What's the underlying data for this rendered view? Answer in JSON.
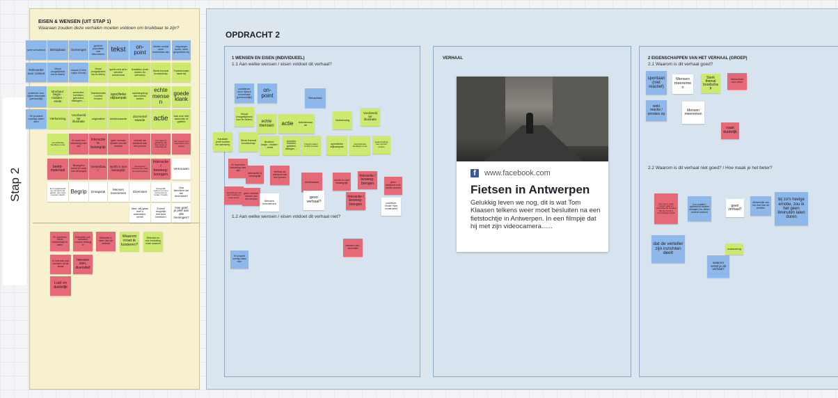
{
  "stap_label": "Stap 2",
  "left_panel": {
    "title": "EISEN & WENSEN (UIT STAP 1)",
    "subtitle": "Waaraan zouden deze verhalen moeten voldoen om bruikbaar te zijn?",
    "stickies": [
      "snel vervelend",
      "Behapbaar",
      "Gemengen",
      "grotere populatie dat interveren",
      "tekst",
      "on-point",
      "idealen omdat meer herkenbaar zijn",
      "mag langer duren, meer gesprekken bij",
      "Relevantie voor context",
      "Visual (mogelijkheid van te delen)",
      "Impact (3 time major events)",
      "Visual (mogelijkheid van te delen)",
      "spelt zich af in wereld/ universum",
      "Karakter (met noden en wensen)",
      "Sterk themal boodschap",
      "Toeleenbare lawn bij",
      "positiever voor rijkere informatie (persoonlijk)",
      "structuur: begin - midden - einde",
      "woorden, beelden, geluiden, dialogen, ...",
      "Transformatie / conflict ervaren",
      "specifieke stijlaanpak",
      "spanningsbog aan eventul anders",
      "echte mensen",
      "goede klank",
      "90 procent overlap laten zien",
      "Herkenning",
      "Voorbeeld ter illustratie",
      "originaliteit",
      "betekenaarde",
      "doorvertel waarde",
      "actie",
      "kan ook met animatie of grafiek",
      "verschillende beeldtypen ook",
      "Er moet een bedoeling mee zijn",
      "Interactie is belangrijk",
      "geen verhaal, emotie van het verhaal",
      "verhaal als startpunt aan een proces",
      "Hoe absurd geleiding van door grote en zekerdaarde",
      "iets visueel, het materiaal in het project",
      "beeld-materiaal",
      "Bewegend beeld (in vaak ook tot langst)",
      "herkenbaar",
      "worth is niet belangrijk",
      "bewegende creating aan twee de totaal fracties",
      "Interactie / beweeg-brengen",
      "Vertrouwen",
      "Er is opgebouwd de moment niet geniet, hoe niets nog kent daarin",
      "Begrip",
      "Draagvlak",
      "Mensen meenemen",
      "Diversiteit",
      "Draagvlak creëren om een consensus te vinden / begrip",
      "Hoe bereiken we die diversiteit?",
      "idee: wij gaan met u wandelen, vertel",
      "Zoveel mogelijk mensen bereiken",
      "Hoe geef je plek aan alle meningen?",
      "Er moet een mens herkenbaar in zitten",
      "Evenzeer ook verhalen rondom betoog of",
      "Behoefte is meer dan het verhaal",
      "Waarom moet ik luisteren?",
      "Relevant en een bedoeling maar waarom",
      "er hele kan met verhalen uit de straat",
      "mensen zien, diversiteit",
      "Luid en duidelijk"
    ]
  },
  "opdracht": {
    "heading": "OPDRACHT 2",
    "col1": {
      "title": "1 WENSEN EN EISEN (INDIVIDUEEL)",
      "q1": "1.1 Aan welke wensen / eisen voldoet dit verhaal?",
      "q2": "1.2 Aan welke wensen / eisen voldoet dit verhaal niet?",
      "stickies": [
        "positiever voor rijkere informatie (persoonlijk)",
        "on-point",
        "Behapbaar",
        "Visual (mogelijkheid van te delen)",
        "echte mensen",
        "actie",
        "betekenaarde",
        "Herkenning",
        "Voorbeeld ter illustratie",
        "Karakter (met noden en wensen)",
        "Sterk themal boodschap",
        "structuur: begin - midden - einde",
        "woorden, beelden, geluiden, dialogen, ...",
        "Transformatie / conflict ervaren",
        "specifieke stijlaanpak",
        "verschillende beeldtypen ook",
        "spanningsbog aan eventul anders",
        "Er moet een bedoeling mee zijn",
        "Interactie is belangrijk",
        "verhaal als startpunt van een proces",
        "herkenbaar",
        "worth is niet belangrijk",
        "Interactie / beweeg-brengen",
        "geen startpunt voor verder proces",
        "verschillend van een invulling in actie tezien",
        "geen verhaal, emotie van het verhaal",
        "Mensen meenemen",
        "geen verhaal?",
        "Interactie / beweeg-brengen",
        "positiever einde? Niet constructief",
        "mensen zien, diversiteit",
        "90 procent overlap laten zien"
      ]
    },
    "col2": {
      "title": "VERHAAL",
      "fb_domain": "www.facebook.com",
      "fb_title": "Fietsen in Antwerpen",
      "fb_desc": "Gelukkig leven we nog, dit is wat Tom Klaasen telkens weer moet besluiten na een fietstochtje in Antwerpen.   In een filmpje dat hij met zijn videocamera......"
    },
    "col3": {
      "title": "2 EIGENSCHAPPEN VAN HET VERHAAL (GROEP)",
      "q1": "2.1 Waarom is dit verhaal goed?",
      "q2": "2.2 Waarom is dit verhaal niet goed? / Hoe maak je het beter?",
      "stickies": [
        "spontaan (niet reactief)",
        "Mensen meenemen",
        "Sterk themal boodschap",
        "Herkenbaar voor velen",
        "wekt reactie / emoties op",
        "Mensen meenemen",
        "naak duidelijk",
        "Zou voor 1 topic moeten gaan en verschillende locaties dat het beeld in beperkingen wordt",
        "Zou positief / oplossend moeten eindigen (nu alleen bewust maken)",
        "geen verhaal?",
        "Afhankelijk van het doel van de verteller",
        "bij zo'n hevige emotie, zou ik het geen 8minuten laten duren",
        "dat de verteller zijn inzichten deelt",
        "nuancering",
        "waarom vertel je dit verhaal?"
      ]
    }
  }
}
